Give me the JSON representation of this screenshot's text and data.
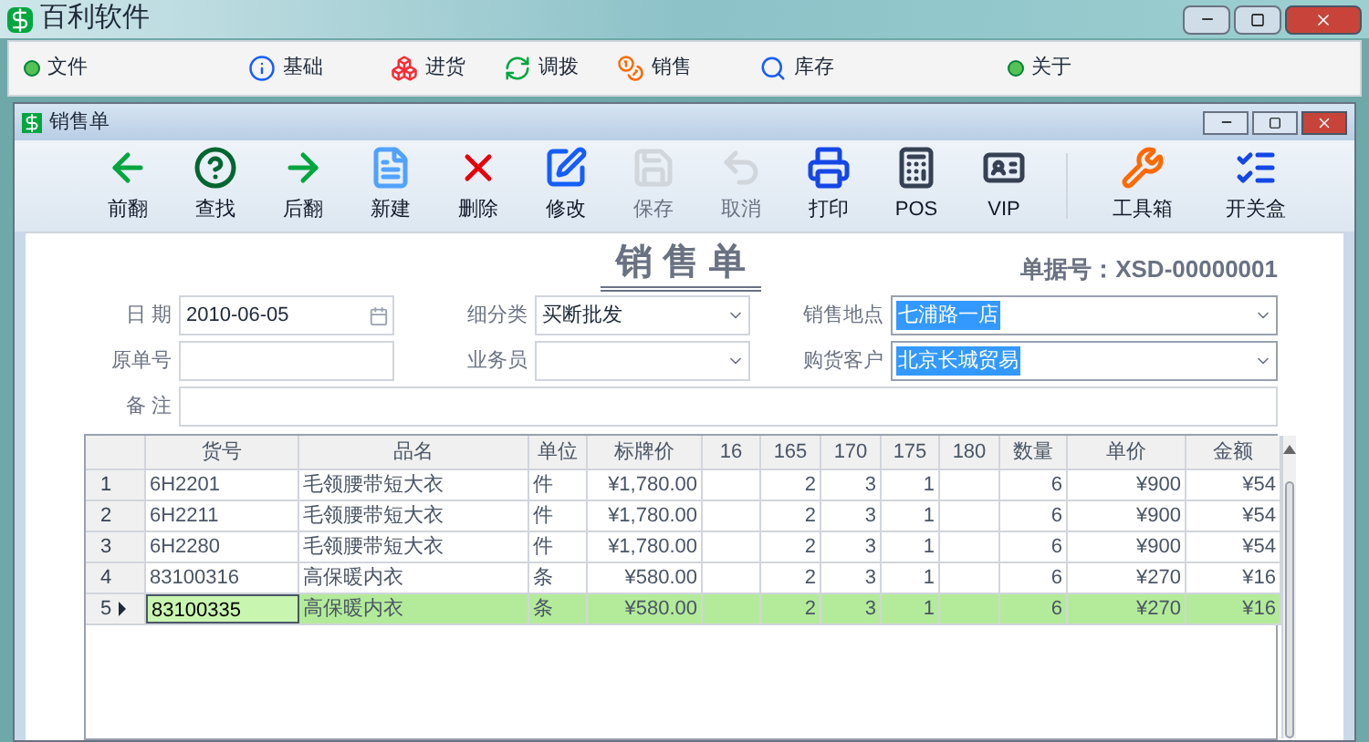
{
  "app": {
    "title": "百利软件"
  },
  "menu": [
    {
      "label": "文件",
      "kind": "dot"
    },
    {
      "label": "基础",
      "kind": "info"
    },
    {
      "label": "进货",
      "kind": "boxes"
    },
    {
      "label": "调拨",
      "kind": "refresh"
    },
    {
      "label": "销售",
      "kind": "coins"
    },
    {
      "label": "库存",
      "kind": "search"
    },
    {
      "label": "关于",
      "kind": "dot"
    }
  ],
  "window": {
    "title": "销售单"
  },
  "toolbar": [
    {
      "label": "前翻",
      "kind": "left",
      "disabled": false
    },
    {
      "label": "查找",
      "kind": "help",
      "disabled": false
    },
    {
      "label": "后翻",
      "kind": "right",
      "disabled": false
    },
    {
      "label": "新建",
      "kind": "new",
      "disabled": false
    },
    {
      "label": "删除",
      "kind": "delete",
      "disabled": false
    },
    {
      "label": "修改",
      "kind": "edit",
      "disabled": false
    },
    {
      "label": "保存",
      "kind": "save",
      "disabled": true
    },
    {
      "label": "取消",
      "kind": "undo",
      "disabled": true
    },
    {
      "label": "打印",
      "kind": "print",
      "disabled": false
    },
    {
      "label": "POS",
      "kind": "pos",
      "disabled": false
    },
    {
      "label": "VIP",
      "kind": "vip",
      "disabled": false
    },
    {
      "label": "工具箱",
      "kind": "tools",
      "disabled": false
    },
    {
      "label": "开关盒",
      "kind": "list",
      "disabled": false
    }
  ],
  "form": {
    "heading": "销 售 单",
    "doc_number": "单据号：XSD-00000001",
    "fields": [
      {
        "label": "日 期",
        "value": "2010-06-05",
        "kind": "date",
        "selected": false
      },
      {
        "label": "细分类",
        "value": "买断批发",
        "kind": "combo",
        "selected": false
      },
      {
        "label": "销售地点",
        "value": "七浦路一店",
        "kind": "combo",
        "selected": true
      },
      {
        "label": "原单号",
        "kind": "text",
        "selected": false
      },
      {
        "label": "业务员",
        "kind": "combo",
        "selected": false
      },
      {
        "label": "购货客户",
        "value": "北京长城贸易",
        "kind": "combo",
        "selected": true
      }
    ],
    "note_label": "备 注"
  },
  "table": {
    "columns": [
      "货号",
      "品名",
      "单位",
      "标牌价",
      "16",
      "165",
      "170",
      "175",
      "180",
      "数量",
      "单价",
      "金额"
    ],
    "rows": [
      {
        "index": "1",
        "selected": false,
        "cells": [
          "6H2201",
          "毛领腰带短大衣",
          "件",
          "¥1,780.00",
          "",
          "2",
          "3",
          "1",
          "",
          "6",
          "¥900",
          "¥54"
        ]
      },
      {
        "index": "2",
        "selected": false,
        "cells": [
          "6H2211",
          "毛领腰带短大衣",
          "件",
          "¥1,780.00",
          "",
          "2",
          "3",
          "1",
          "",
          "6",
          "¥900",
          "¥54"
        ]
      },
      {
        "index": "3",
        "selected": false,
        "cells": [
          "6H2280",
          "毛领腰带短大衣",
          "件",
          "¥1,780.00",
          "",
          "2",
          "3",
          "1",
          "",
          "6",
          "¥900",
          "¥54"
        ]
      },
      {
        "index": "4",
        "selected": false,
        "cells": [
          "83100316",
          "高保暖内衣",
          "条",
          "¥580.00",
          "",
          "2",
          "3",
          "1",
          "",
          "6",
          "¥270",
          "¥16"
        ]
      },
      {
        "index": "5",
        "selected": true,
        "cells": [
          "83100335",
          "高保暖内衣",
          "条",
          "¥580.00",
          "",
          "2",
          "3",
          "1",
          "",
          "6",
          "¥270",
          "¥16"
        ]
      }
    ]
  }
}
